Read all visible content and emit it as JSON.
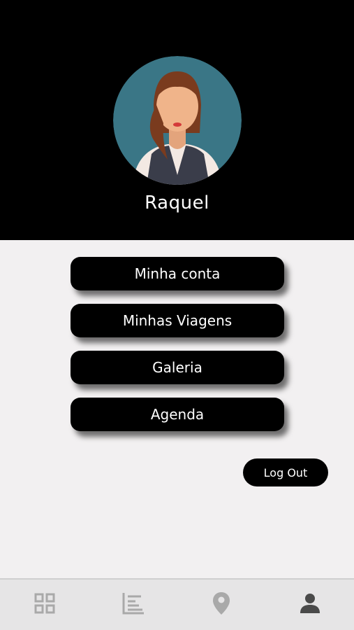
{
  "profile": {
    "name": "Raquel",
    "avatar_icon": "woman-avatar-icon"
  },
  "menu": {
    "items": [
      {
        "label": "Minha conta"
      },
      {
        "label": "Minhas Viagens"
      },
      {
        "label": "Galeria"
      },
      {
        "label": "Agenda"
      }
    ]
  },
  "logout": {
    "label": "Log Out"
  },
  "bottom_nav": {
    "items": [
      {
        "icon": "grid-icon",
        "active": false
      },
      {
        "icon": "list-chart-icon",
        "active": false
      },
      {
        "icon": "location-pin-icon",
        "active": false
      },
      {
        "icon": "person-icon",
        "active": true
      }
    ]
  },
  "colors": {
    "header_bg": "#000000",
    "body_bg": "#f2f0f1",
    "avatar_bg": "#3a7686",
    "nav_inactive": "#a9a9a9",
    "nav_active": "#4a4a4a"
  }
}
